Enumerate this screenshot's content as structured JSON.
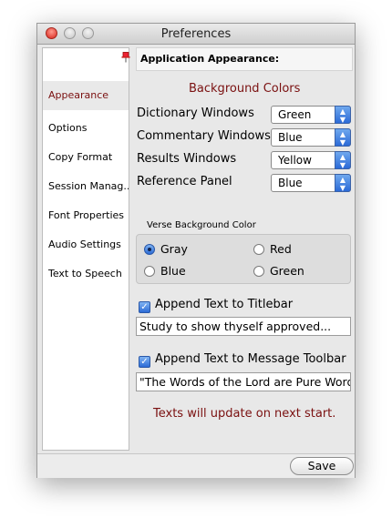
{
  "window": {
    "title": "Preferences"
  },
  "sidebar": {
    "items": [
      {
        "label": "Appearance"
      },
      {
        "label": "Options"
      },
      {
        "label": "Copy Format"
      },
      {
        "label": "Session Manag.."
      },
      {
        "label": "Font Properties"
      },
      {
        "label": "Audio Settings"
      },
      {
        "label": "Text to Speech"
      }
    ]
  },
  "main": {
    "header": "Application Appearance:",
    "background_colors_title": "Background Colors",
    "rows": [
      {
        "label": "Dictionary Windows",
        "value": "Green"
      },
      {
        "label": "Commentary Windows",
        "value": "Blue"
      },
      {
        "label": "Results Windows",
        "value": "Yellow"
      },
      {
        "label": "Reference Panel",
        "value": "Blue"
      }
    ],
    "verse_bg_label": "Verse Background Color",
    "radios": [
      {
        "label": "Gray",
        "selected": true
      },
      {
        "label": "Red",
        "selected": false
      },
      {
        "label": "Blue",
        "selected": false
      },
      {
        "label": "Green",
        "selected": false
      }
    ],
    "append_titlebar": {
      "label": "Append Text to Titlebar",
      "checked": true,
      "value": "Study to show thyself approved..."
    },
    "append_toolbar": {
      "label": "Append Text to Message Toolbar",
      "checked": true,
      "value": "\"The Words of the Lord are Pure Words"
    },
    "notice": "Texts will update on next start."
  },
  "footer": {
    "save_label": "Save"
  },
  "colors": {
    "accent_text": "#7a1010",
    "control_blue": "#2c6bd6"
  }
}
